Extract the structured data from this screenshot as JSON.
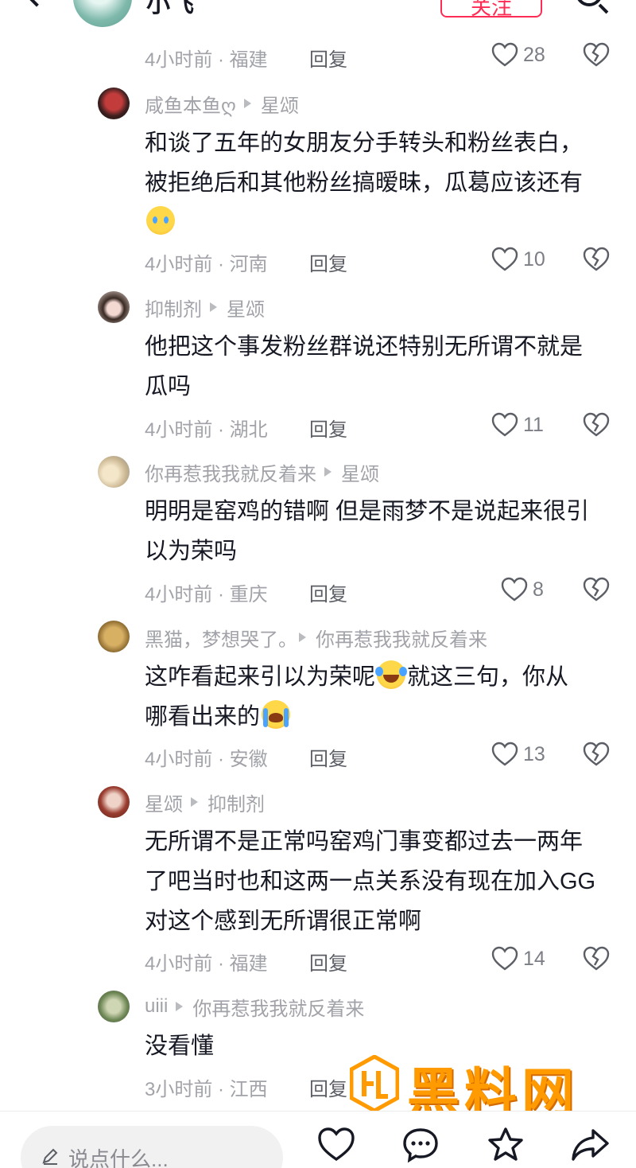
{
  "header": {
    "user_name": "小飞",
    "follow_label": "关注",
    "icons": [
      "back-icon",
      "search-icon"
    ]
  },
  "top_footer": {
    "time_location": "4小时前 · 福建",
    "reply_label": "回复",
    "likes": "28"
  },
  "comments": [
    {
      "user": "咸鱼本鱼ღ",
      "reply_to": "星颂",
      "lines": [
        "和谈了五年的女朋友分手转头和粉丝表白，",
        "被拒绝后和其他粉丝搞暧昧，瓜葛应该还有"
      ],
      "emoji_line": "crying-face-emoji",
      "time_location": "4小时前 · 河南",
      "reply_label": "回复",
      "likes": "10"
    },
    {
      "user": "抑制剂",
      "reply_to": "星颂",
      "lines": [
        "他把这个事发粉丝群说还特别无所谓不就是",
        "瓜吗"
      ],
      "time_location": "4小时前 · 湖北",
      "reply_label": "回复",
      "likes": "11"
    },
    {
      "user": "你再惹我我就反着来",
      "reply_to": "星颂",
      "lines": [
        "明明是窑鸡的错啊 但是雨梦不是说起来很引",
        "以为荣吗"
      ],
      "time_location": "4小时前 · 重庆",
      "reply_label": "回复",
      "likes": "8"
    },
    {
      "user": "黑猫，梦想哭了。",
      "reply_to": "你再惹我我就反着来",
      "line1_a": "这咋看起来引以为荣呢",
      "line1_b": "就这三句，你从",
      "line2": "哪看出来的",
      "time_location": "4小时前 · 安徽",
      "reply_label": "回复",
      "likes": "13"
    },
    {
      "user": "星颂",
      "reply_to": "抑制剂",
      "lines": [
        "无所谓不是正常吗窑鸡门事变都过去一两年",
        "了吧当时也和这两一点关系没有现在加入GG",
        "对这个感到无所谓很正常啊"
      ],
      "time_location": "4小时前 · 福建",
      "reply_label": "回复",
      "likes": "14"
    },
    {
      "user": "uiii",
      "reply_to": "你再惹我我就反着来",
      "lines": [
        "没看懂"
      ],
      "time_location": "3小时前 · 江西",
      "reply_label": "回复"
    }
  ],
  "bottom_bar": {
    "input_placeholder": "说点什么...",
    "icons": [
      "like-icon",
      "comment-icon",
      "favorite-icon",
      "share-icon"
    ]
  },
  "watermark": {
    "title": "黑料网",
    "url": "https://hlwe16.com"
  },
  "colors": {
    "accent": "#fe2c55",
    "meta_text": "#a1a3a8",
    "body_text": "#161823",
    "watermark": "#ff9a00"
  }
}
